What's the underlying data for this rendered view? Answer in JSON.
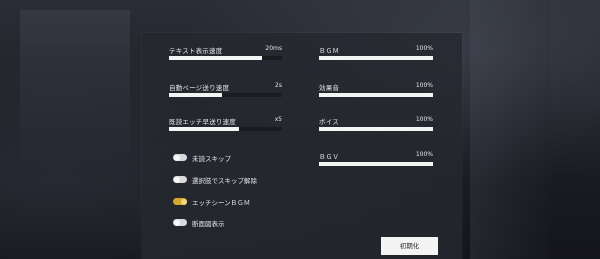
{
  "left_sliders": [
    {
      "label": "テキスト表示速度",
      "value": "20ms",
      "level": 0.82
    },
    {
      "label": "自動ページ送り速度",
      "value": "2s",
      "level": 0.47
    },
    {
      "label": "既読エッチ早送り速度",
      "value": "x5",
      "level": 0.62
    }
  ],
  "right_sliders": [
    {
      "label": "ＢＧＭ",
      "value": "100%",
      "level": 1.0
    },
    {
      "label": "効果音",
      "value": "100%",
      "level": 1.0
    },
    {
      "label": "ボイス",
      "value": "100%",
      "level": 1.0
    },
    {
      "label": "ＢＧＶ",
      "value": "100%",
      "level": 1.0
    }
  ],
  "toggles": [
    {
      "label": "未読スキップ",
      "on": false
    },
    {
      "label": "選択肢でスキップ解除",
      "on": false
    },
    {
      "label": "エッチシーンＢＧＭ",
      "on": true
    },
    {
      "label": "断面図表示",
      "on": false
    }
  ],
  "reset_label": "初期化",
  "colors": {
    "toggle_on": "#d4a82c",
    "toggle_off": "#d9d9dd",
    "slider_fill": "#f4f4f4",
    "slider_track": "#1a1b20"
  }
}
